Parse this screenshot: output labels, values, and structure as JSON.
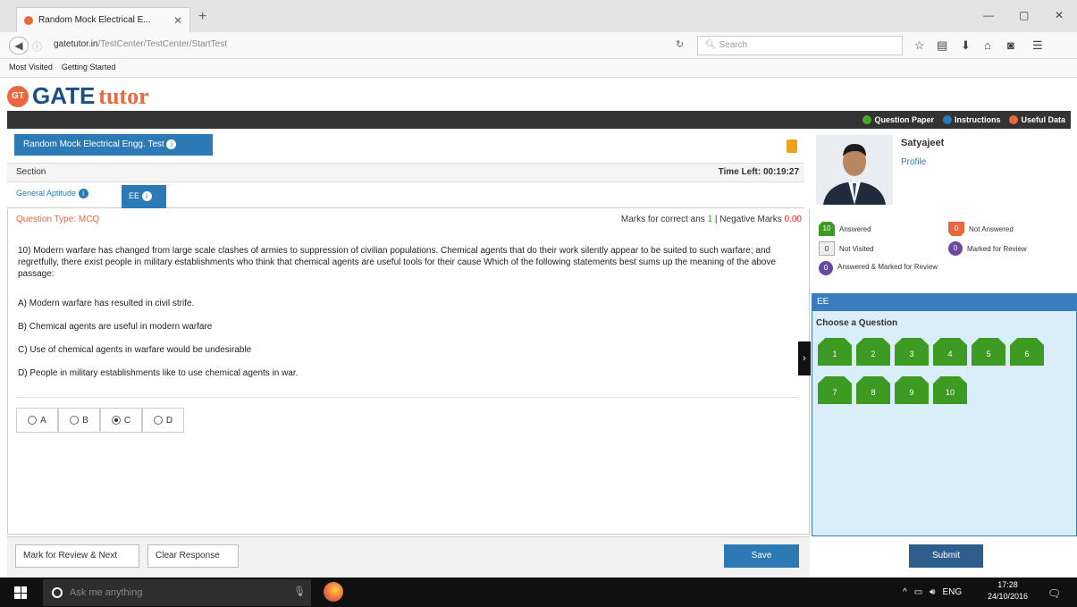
{
  "browser": {
    "tab_title": "Random Mock Electrical E...",
    "tab_close": "✕",
    "new_tab": "+",
    "url_host": "gatetutor.in",
    "url_path": "/TestCenter/TestCenter/StartTest",
    "search_placeholder": "Search",
    "window_controls": [
      "—",
      "▢",
      "✕"
    ],
    "bookmarks": [
      "Most Visited",
      "Getting Started"
    ]
  },
  "brand": {
    "badge": "GT",
    "part1": "GATE",
    "part2": "tutor"
  },
  "topbar": {
    "links": [
      {
        "label": "Question Paper",
        "color": "#4aa82c"
      },
      {
        "label": "Instructions",
        "color": "#2c7ab5"
      },
      {
        "label": "Useful Data",
        "color": "#e8683f"
      }
    ]
  },
  "test": {
    "name": "Random Mock Electrical Engg. Test",
    "section_label": "Section",
    "time_left": "Time Left: 00:19:27",
    "sections": [
      {
        "label": "General Aptitude",
        "active": false
      },
      {
        "label": "EE",
        "active": true
      }
    ]
  },
  "question": {
    "type_label": "Question Type: MCQ",
    "marks_prefix": "Marks for correct ans",
    "marks_correct": "1",
    "marks_sep": "| Negative Marks",
    "marks_negative": "0.00",
    "text": "10) Modern warfare has changed from large scale clashes of armies to suppression of civilian populations. Chemical agents that do their work silently appear to be suited to such warfare; and regretfully, there exist people in military establishments who think that chemical agents are useful tools for their cause Which of the following statements best sums up the meaning of the above passage:",
    "options": [
      "A) Modern warfare has resulted in civil strife.",
      "B) Chemical agents are useful in modern warfare",
      "C) Use of chemical agents in warfare would be undesirable",
      "D) People in military establishments like to use chemical agents in war."
    ],
    "choices": [
      "A",
      "B",
      "C",
      "D"
    ],
    "selected": "C"
  },
  "actions": {
    "mark_review": "Mark for Review & Next",
    "clear": "Clear Response",
    "save": "Save",
    "submit": "Submit"
  },
  "user": {
    "name": "Satyajeet",
    "profile_link": "Profile"
  },
  "legend": {
    "answered": {
      "count": "10",
      "label": "Answered"
    },
    "not_answered": {
      "count": "0",
      "label": "Not Answered"
    },
    "not_visited": {
      "count": "0",
      "label": "Not Visited"
    },
    "marked_review": {
      "count": "0",
      "label": "Marked for Review"
    },
    "answered_marked": {
      "count": "0",
      "label": "Answered & Marked for Review"
    }
  },
  "palette": {
    "section": "EE",
    "heading": "Choose a Question",
    "questions": [
      "1",
      "2",
      "3",
      "4",
      "5",
      "6",
      "7",
      "8",
      "9",
      "10"
    ]
  },
  "taskbar": {
    "search_placeholder": "Ask me anything",
    "lang": "ENG",
    "time": "17:28",
    "date": "24/10/2016"
  },
  "colors": {
    "primary": "#2c7ab5",
    "answered_green": "#3d9b23",
    "accent_orange": "#e8683f",
    "review_purple": "#6a4aa0"
  }
}
